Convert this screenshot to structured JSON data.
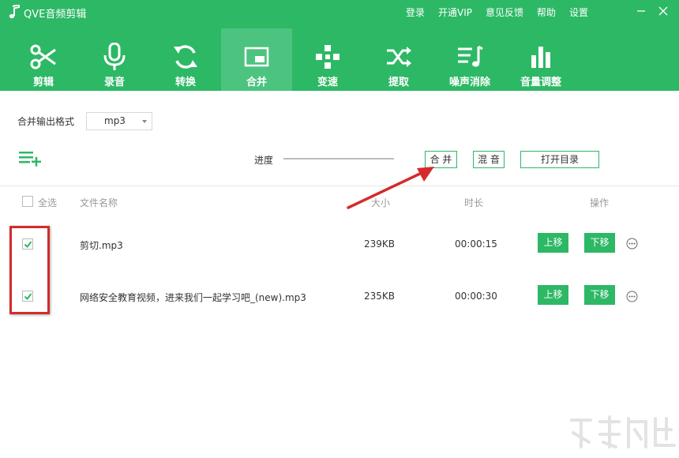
{
  "app": {
    "title": "QVE音频剪辑"
  },
  "top_links": [
    "登录",
    "开通VIP",
    "意见反馈",
    "帮助",
    "设置"
  ],
  "toolbar": [
    {
      "label": "剪辑",
      "icon": "scissors-icon"
    },
    {
      "label": "录音",
      "icon": "microphone-icon"
    },
    {
      "label": "转换",
      "icon": "convert-icon"
    },
    {
      "label": "合并",
      "icon": "merge-icon",
      "active": true
    },
    {
      "label": "变速",
      "icon": "speed-icon"
    },
    {
      "label": "提取",
      "icon": "shuffle-icon"
    },
    {
      "label": "噪声消除",
      "icon": "noise-icon"
    },
    {
      "label": "音量调整",
      "icon": "volume-bars-icon"
    }
  ],
  "format": {
    "label": "合并输出格式",
    "value": "mp3"
  },
  "progress": {
    "label": "进度",
    "value": 0
  },
  "buttons": {
    "merge": "合 并",
    "mix": "混 音",
    "open_dir": "打开目录"
  },
  "table": {
    "select_all": "全选",
    "headers": {
      "name": "文件名称",
      "size": "大小",
      "duration": "时长",
      "ops": "操作"
    },
    "rows": [
      {
        "name": "剪切.mp3",
        "size": "239KB",
        "duration": "00:00:15",
        "checked": true
      },
      {
        "name": "网络安全教育视频，进来我们一起学习吧_(new).mp3",
        "size": "235KB",
        "duration": "00:00:30",
        "checked": true
      }
    ],
    "move_up": "上移",
    "move_down": "下移"
  },
  "colors": {
    "brand": "#2db865",
    "active_tab": "#4cc47f",
    "annotation": "#d42b2b"
  }
}
